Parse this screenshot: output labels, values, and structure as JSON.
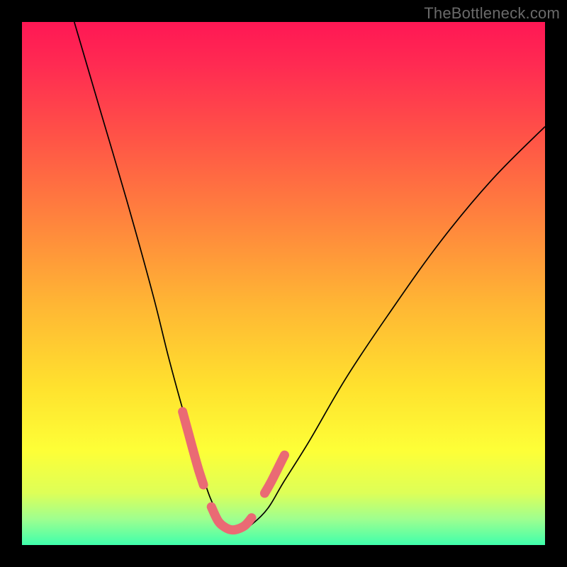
{
  "watermark": "TheBottleneck.com",
  "colors": {
    "background": "#000000",
    "curve": "#000000",
    "accent": "#ea6a74",
    "gradient_stops": [
      "#ff1754",
      "#ff2a52",
      "#ff5347",
      "#ff843d",
      "#ffb634",
      "#ffe22e",
      "#fdff37",
      "#deff57",
      "#9fff8f",
      "#3fffac"
    ]
  },
  "chart_data": {
    "type": "line",
    "title": "",
    "xlabel": "",
    "ylabel": "",
    "xlim": [
      0,
      100
    ],
    "ylim": [
      0,
      100
    ],
    "series": [
      {
        "name": "bottleneck-curve",
        "x": [
          10,
          15,
          20,
          25,
          28,
          31,
          34,
          36,
          38,
          40,
          42,
          44,
          47,
          50,
          55,
          62,
          70,
          80,
          90,
          100
        ],
        "y": [
          100,
          83,
          66,
          48,
          36,
          25,
          15,
          9,
          5,
          3,
          3,
          4,
          7,
          12,
          20,
          32,
          44,
          58,
          70,
          80
        ]
      }
    ],
    "accent_segments": [
      {
        "name": "left-descent",
        "x": [
          30.7,
          31.8,
          32.8,
          33.8,
          34.7
        ],
        "y": [
          25.5,
          21.5,
          17.8,
          14.3,
          11.5
        ]
      },
      {
        "name": "valley-floor",
        "x": [
          36.2,
          37.5,
          38.8,
          40.1,
          41.4,
          42.7,
          43.9
        ],
        "y": [
          7.3,
          4.6,
          3.4,
          2.9,
          3.1,
          3.8,
          5.2
        ]
      },
      {
        "name": "right-ascent",
        "x": [
          46.4,
          47.7,
          48.9,
          50.2
        ],
        "y": [
          9.9,
          12.2,
          14.6,
          17.2
        ]
      }
    ]
  }
}
